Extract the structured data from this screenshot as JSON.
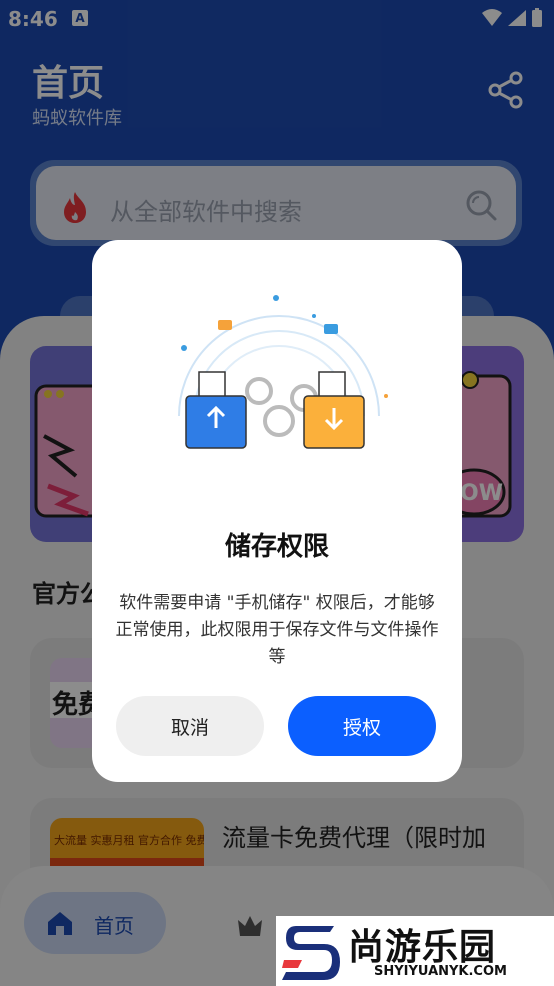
{
  "status_bar": {
    "time": "8:46",
    "notification_icon": "A"
  },
  "header": {
    "title": "首页",
    "subtitle": "蚂蚁软件库",
    "share_icon": "share-icon"
  },
  "search": {
    "placeholder": "从全部软件中搜索"
  },
  "content": {
    "section_title": "官方公",
    "card2_title": "流量卡免费代理（限时加",
    "card1_thumb_text": "免费",
    "card2_thumb_text": "大流量 实惠月租 官方合作 免费包"
  },
  "bottom_nav": {
    "home_label": "首页"
  },
  "dialog": {
    "title": "储存权限",
    "message": "软件需要申请 \"手机储存\" 权限后，才能够正常使用，此权限用于保存文件与文件操作等",
    "cancel_label": "取消",
    "grant_label": "授权"
  },
  "watermark": {
    "brand": "尚游乐园",
    "url": "SHYIYUANYK.COM"
  },
  "colors": {
    "primary": "#1d4ab1",
    "accent_button": "#0b5fff",
    "flame": "#e8383d"
  }
}
